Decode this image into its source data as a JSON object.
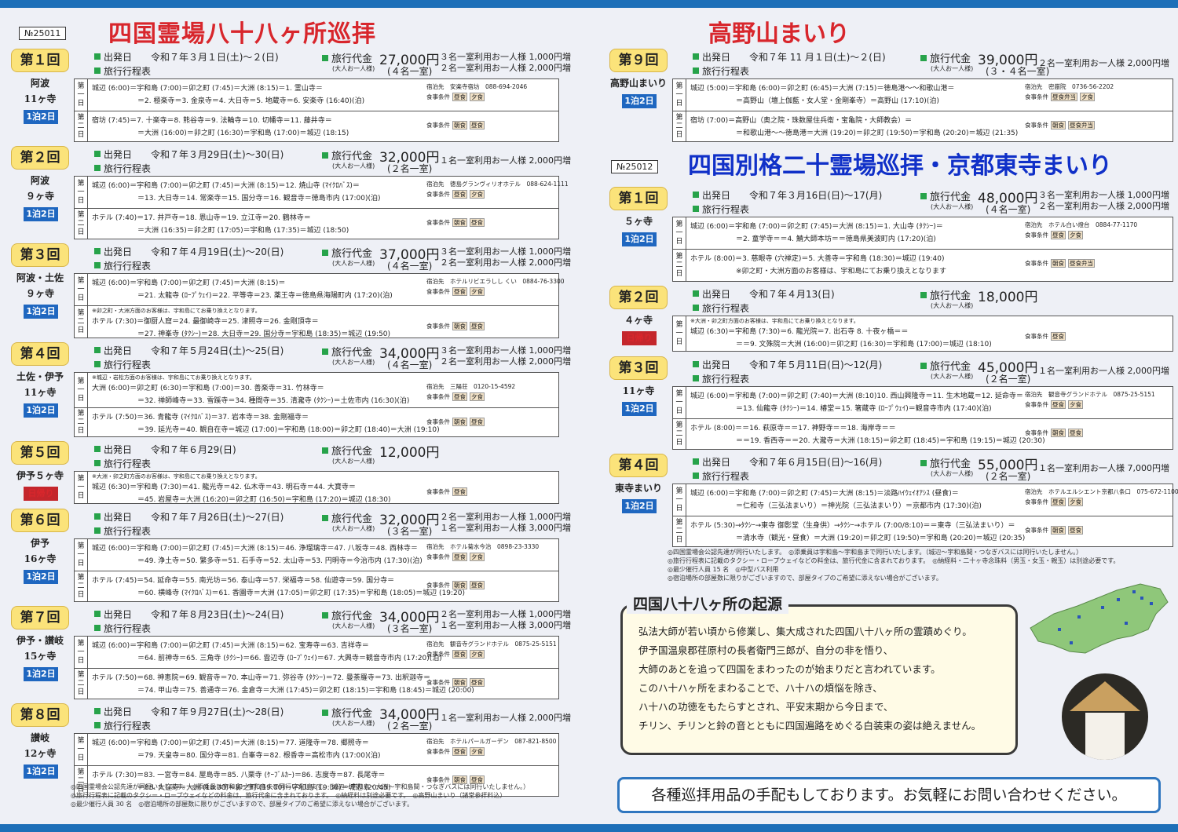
{
  "left": {
    "serial": "№25011",
    "title": "四国霊場八十八ヶ所巡拝",
    "trips": [
      {
        "badge": "第１回",
        "region": [
          "阿波",
          "11ヶ寺"
        ],
        "duration": "1泊2日",
        "date": "令和７年３月１日(土)～２(日)",
        "price": "27,000円",
        "occ": "(４名一室)",
        "extra": [
          "３名一室利用お一人様 1,000円増",
          "２名一室利用お一人様 2,000円増"
        ],
        "day1": [
          "城辺 (6:00)＝宇和島 (7:00)＝卯之町 (7:45)＝大洲 (8:15)＝1. 霊山寺＝",
          "＝2. 極楽寺＝3. 金泉寺＝4. 大日寺＝5. 地蔵寺＝6. 安楽寺 (16:40)(泊)"
        ],
        "lodge": "宿泊先　安楽寺宿坊　088-694-2046",
        "meal1": [
          "昼食",
          "夕食"
        ],
        "day2": [
          "宿坊 (7:45)＝7. 十楽寺＝8. 熊谷寺＝9. 法輪寺＝10. 切幡寺＝11. 藤井寺＝",
          "＝大洲 (16:00)＝卯之町 (16:30)＝宇和島 (17:00)＝城辺 (18:15)"
        ],
        "meal2": [
          "朝食",
          "昼食"
        ]
      },
      {
        "badge": "第２回",
        "region": [
          "阿波",
          "９ヶ寺"
        ],
        "duration": "1泊2日",
        "date": "令和７年３月29日(土)～30(日)",
        "price": "32,000円",
        "occ": "(２名一室)",
        "extra": [
          "１名一室利用お一人様 2,000円増"
        ],
        "day1": [
          "城辺 (6:00)＝宇和島 (7:00)＝卯之町 (7:45)＝大洲 (8:15)＝12. 焼山寺 (ﾏｲｸﾛﾊﾞｽ)＝",
          "＝13. 大日寺＝14. 常楽寺＝15. 国分寺＝16. 観音寺＝徳島市内 (17:00)(泊)"
        ],
        "lodge": "宿泊先　徳島グランヴィリオホテル　088-624-1111",
        "meal1": [
          "昼食",
          "夕食"
        ],
        "day2": [
          "ホテル (7:40)＝17. 井戸寺＝18. 恩山寺＝19. 立江寺＝20. 鶴林寺＝",
          "＝大洲 (16:35)＝卯之町 (17:05)＝宇和島 (17:35)＝城辺 (18:50)"
        ],
        "meal2": [
          "朝食",
          "昼食"
        ]
      },
      {
        "badge": "第３回",
        "region": [
          "阿波・土佐",
          "９ヶ寺"
        ],
        "duration": "1泊2日",
        "date": "令和７年４月19日(土)～20(日)",
        "price": "37,000円",
        "occ": "(４名一室)",
        "extra": [
          "３名一室利用お一人様 1,000円増",
          "２名一室利用お一人様 2,000円増"
        ],
        "day1": [
          "城辺 (6:00)＝宇和島 (7:00)＝卯之町 (7:45)＝大洲 (8:15)＝",
          "＝21. 太龍寺 (ﾛｰﾌﾟｳｪｲ)＝22. 平等寺＝23. 薬王寺＝徳島県海陽町内 (17:20)(泊)"
        ],
        "lodge": "宿泊先　ホテルリビエラしし くい　0884-76-3300",
        "meal1": [
          "昼食",
          "夕食"
        ],
        "day2": [
          "ホテル (7:30)＝御厨人窟＝24. 最御崎寺＝25. 津照寺＝26. 金剛頂寺＝",
          "＝27. 神峯寺 (ﾀｸｼｰ)＝28. 大日寺＝29. 国分寺＝宇和島 (18:35)＝城辺 (19:50)"
        ],
        "meal2": [
          "朝食",
          "昼食"
        ],
        "note2": "※卯之町・大洲方面のお客様は、宇和島にてお乗り換えとなります。"
      },
      {
        "badge": "第４回",
        "region": [
          "土佐・伊予",
          "11ヶ寺"
        ],
        "duration": "1泊2日",
        "date": "令和７年５月24日(土)～25(日)",
        "price": "34,000円",
        "occ": "(４名一室)",
        "extra": [
          "３名一室利用お一人様 1,000円増",
          "２名一室利用お一人様 2,000円増"
        ],
        "note1": "※城辺・岩松方面のお客様は、宇和島にてお乗り換えとなります。",
        "day1": [
          "大洲 (6:00)＝卯之町 (6:30)＝宇和島 (7:00)＝30. 善楽寺＝31. 竹林寺＝",
          "＝32. 禅師峰寺＝33. 雪蹊寺＝34. 種間寺＝35. 清瀧寺 (ﾀｸｼｰ)＝土佐市内 (16:30)(泊)"
        ],
        "lodge": "宿泊先　三陽荘　0120-15-4592",
        "meal1": [
          "昼食",
          "夕食"
        ],
        "day2": [
          "ホテル (7:50)＝36. 青龍寺 (ﾏｲｸﾛﾊﾞｽ)＝37. 岩本寺＝38. 金剛福寺＝",
          "＝39. 延光寺＝40. 観自在寺＝城辺 (17:00)＝宇和島 (18:00)＝卯之町 (18:40)＝大洲 (19:10)"
        ],
        "meal2": [
          "朝食",
          "昼食"
        ]
      },
      {
        "badge": "第５回",
        "region": [
          "伊予５ヶ寺"
        ],
        "duration": "日帰り",
        "date": "令和７年６月29(日)",
        "price": "12,000円",
        "occ": "",
        "extra": [],
        "note1": "※大洲・卯之町方面のお客様は、宇和島にてお乗り換えとなります。",
        "day1": [
          "城辺 (6:30)＝宇和島 (7:30)＝41. 龍光寺＝42. 仏木寺＝43. 明石寺＝44. 大寶寺＝",
          "＝45. 岩屋寺＝大洲 (16:20)＝卯之町 (16:50)＝宇和島 (17:20)＝城辺 (18:30)"
        ],
        "meal1": [
          "昼食"
        ]
      },
      {
        "badge": "第６回",
        "region": [
          "伊予",
          "16ヶ寺"
        ],
        "duration": "1泊2日",
        "date": "令和７年７月26日(土)～27(日)",
        "price": "32,000円",
        "occ": "(３名一室)",
        "extra": [
          "２名一室利用お一人様 1,000円増",
          "１名一室利用お一人様 3,000円増"
        ],
        "day1": [
          "城辺 (6:00)＝宇和島 (7:00)＝卯之町 (7:45)＝大洲 (8:15)＝46. 浄瑠璃寺＝47. 八坂寺＝48. 西林寺＝",
          "＝49. 浄土寺＝50. 繁多寺＝51. 石手寺＝52. 太山寺＝53. 円明寺＝今治市内 (17:30)(泊)"
        ],
        "lodge": "宿泊先　ホテル菊水今治　0898-23-3330",
        "meal1": [
          "昼食",
          "夕食"
        ],
        "day2": [
          "ホテル (7:45)＝54. 延命寺＝55. 南光坊＝56. 泰山寺＝57. 栄福寺＝58. 仙遊寺＝59. 国分寺＝",
          "＝60. 横峰寺 (ﾏｲｸﾛﾊﾞｽ)＝61. 香園寺＝大洲 (17:05)＝卯之町 (17:35)＝宇和島 (18:05)＝城辺 (19:20)"
        ],
        "meal2": [
          "朝食",
          "昼食"
        ]
      },
      {
        "badge": "第７回",
        "region": [
          "伊予・讃岐",
          "15ヶ寺"
        ],
        "duration": "1泊2日",
        "date": "令和７年８月23日(土)～24(日)",
        "price": "34,000円",
        "occ": "(３名一室)",
        "extra": [
          "２名一室利用お一人様 1,000円増",
          "１名一室利用お一人様 3,000円増"
        ],
        "day1": [
          "城辺 (6:00)＝宇和島 (7:00)＝卯之町 (7:45)＝大洲 (8:15)＝62. 宝寿寺＝63. 吉祥寺＝",
          "＝64. 前神寺＝65. 三角寺 (ﾀｸｼｰ)＝66. 雲辺寺 (ﾛｰﾌﾟｳｪｲ)＝67. 大興寺＝観音寺市内 (17:20)(泊)"
        ],
        "lodge": "宿泊先　観音寺グランドホテル　0875-25-5151",
        "meal1": [
          "昼食",
          "夕食"
        ],
        "day2": [
          "ホテル (7:50)＝68. 神恵院＝69. 観音寺＝70. 本山寺＝71. 弥谷寺 (ﾀｸｼｰ)＝72. 曼荼羅寺＝73. 出釈迦寺＝",
          "＝74. 甲山寺＝75. 善通寺＝76. 金倉寺＝大洲 (17:45)＝卯之町 (18:15)＝宇和島 (18:45)＝城辺 (20:00)"
        ],
        "meal2": [
          "朝食",
          "昼食"
        ]
      },
      {
        "badge": "第８回",
        "region": [
          "讃岐",
          "12ヶ寺"
        ],
        "duration": "1泊2日",
        "date": "令和７年９月27日(土)～28(日)",
        "price": "34,000円",
        "occ": "(２名一室)",
        "extra": [
          "１名一室利用お一人様 2,000円増"
        ],
        "day1": [
          "城辺 (6:00)＝宇和島 (7:00)＝卯之町 (7:45)＝大洲 (8:15)＝77. 道隆寺＝78. 郷照寺＝",
          "＝79. 天皇寺＝80. 国分寺＝81. 白峯寺＝82. 根香寺＝高松市内 (17:00)(泊)"
        ],
        "lodge": "宿泊先　ホテルパールガーデン　087-821-8500",
        "meal1": [
          "昼食",
          "夕食"
        ],
        "day2": [
          "ホテル (7:30)＝83. 一宮寺＝84. 屋島寺＝85. 八栗寺 (ｹｰﾌﾞﾙｶｰ)＝86. 志度寺＝87. 長尾寺＝",
          "＝88. 大窪寺＝大洲 (18:30)＝卯之町 (19:00)＝宇和島 (19:30)＝城辺 (20:45)"
        ],
        "meal2": [
          "朝食",
          "昼食"
        ]
      }
    ],
    "notes": [
      "◎四国霊場会公認先達が同行いたします。　◎添乗員は宇和島～宇和島まで同行いたします。（城辺～宇和島・大洲～宇和島間・つなぎバスには同行いたしません。）",
      "◎旅行行程表に記載のタクシー・ロープウェイなどの料金は、旅行代金に含まれております。　◎納経料は別途必要です。　◎高野山まいり（諸堂参拝料込）",
      "◎最少催行人員 30 名　◎宿泊場所の部屋数に限りがございますので、部屋タイプのご希望に添えない場合がございます。"
    ]
  },
  "right": {
    "title1": "高野山まいり",
    "koya": {
      "badge": "第９回",
      "region": [
        "高野山まいり"
      ],
      "duration": "1泊2日",
      "date": "令和７年 11 月１日(土)～２(日)",
      "price": "39,000円",
      "occ": "(３・４名一室)",
      "extra": [
        "２名一室利用お一人様 2,000円増"
      ],
      "day1": [
        "城辺 (5:00)＝宇和島 (6:00)＝卯之町 (6:45)＝大洲 (7:15)＝徳島港～～和歌山港＝",
        "＝高野山（壇上伽藍・女人堂・金剛峯寺）＝高野山 (17:10)(泊)"
      ],
      "lodge": "宿泊先　密厳院　0736-56-2202",
      "meal1": [
        "昼食弁当",
        "夕食"
      ],
      "day2": [
        "宿坊 (7:00)＝高野山（奥之院・珠数屋住兵衛・宝亀院・大師教会）＝",
        "＝和歌山港～～徳島港＝大洲 (19:20)＝卯之町 (19:50)＝宇和島 (20:20)＝城辺 (21:35)"
      ],
      "meal2": [
        "朝食",
        "昼食弁当"
      ]
    },
    "serial2": "№25012",
    "title2": "四国別格二十霊場巡拝・京都東寺まいり",
    "trips": [
      {
        "badge": "第１回",
        "region": [
          "５ヶ寺"
        ],
        "duration": "1泊2日",
        "date": "令和７年３月16日(日)～17(月)",
        "price": "48,000円",
        "occ": "(４名一室)",
        "extra": [
          "３名一室利用お一人様 1,000円増",
          "２名一室利用お一人様 2,000円増"
        ],
        "day1": [
          "城辺 (6:00)＝宇和島 (7:00)＝卯之町 (7:45)＝大洲 (8:15)＝1. 大山寺 (ﾀｸｼｰ)＝",
          "＝2. 童学寺＝＝4. 鯖大師本坊＝＝徳島県美波町内 (17:20)(泊)"
        ],
        "lodge": "宿泊先　ホテル白い燈台　0884-77-1170",
        "meal1": [
          "昼食",
          "夕食"
        ],
        "day2": [
          "ホテル (8:00)＝3. 慈眼寺 (穴禅定)＝5. 大善寺＝宇和島 (18:30)＝城辺 (19:40)",
          "※卯之町・大洲方面のお客様は、宇和島にてお乗り換えとなります"
        ],
        "meal2": [
          "朝食",
          "昼食弁当"
        ]
      },
      {
        "badge": "第２回",
        "region": [
          "４ヶ寺"
        ],
        "duration": "日帰り",
        "date": "令和７年４月13(日)",
        "price": "18,000円",
        "occ": "",
        "extra": [],
        "note1": "※大洲・卯之町方面のお客様は、宇和島にてお乗り換えとなります。",
        "day1": [
          "城辺 (6:30)＝宇和島 (7:30)＝6. 龍光院＝7. 出石寺 8. 十夜ヶ橋＝＝",
          "＝＝9. 文殊院＝大洲 (16:00)＝卯之町 (16:30)＝宇和島 (17:00)＝城辺 (18:10)"
        ],
        "meal1": [
          "昼食"
        ]
      },
      {
        "badge": "第３回",
        "region": [
          "11ヶ寺"
        ],
        "duration": "1泊2日",
        "date": "令和７年５月11日(日)～12(月)",
        "price": "45,000円",
        "occ": "(２名一室)",
        "extra": [
          "１名一室利用お一人様 2,000円増"
        ],
        "day1": [
          "城辺 (6:00)＝宇和島 (7:00)＝卯之町 (7:40)＝大洲 (8:10)10. 西山興隆寺＝11. 生木地蔵＝12. 延命寺＝",
          "＝13. 仙龍寺 (ﾀｸｼｰ)＝14. 椿堂＝15. 箸蔵寺 (ﾛｰﾌﾟｳｪｲ)＝観音寺市内 (17:40)(泊)"
        ],
        "lodge": "宿泊先　観音寺グランドホテル　0875-25-5151",
        "meal1": [
          "昼食",
          "夕食"
        ],
        "day2": [
          "ホテル (8:00)＝＝16. 萩原寺＝＝17. 神野寺＝＝18. 海岸寺＝＝",
          "＝＝19. 香西寺＝＝20. 大瀧寺＝大洲 (18:15)＝卯之町 (18:45)＝宇和島 (19:15)＝城辺 (20:30)"
        ],
        "meal2": [
          "朝食",
          "昼食"
        ]
      },
      {
        "badge": "第４回",
        "region": [
          "東寺まいり"
        ],
        "duration": "1泊2日",
        "date": "令和７年６月15日(日)～16(月)",
        "price": "55,000円",
        "occ": "(２名一室)",
        "extra": [
          "１名一室利用お一人様 7,000円増"
        ],
        "day1": [
          "城辺 (6:00)＝宇和島 (7:00)＝卯之町 (7:45)＝大洲 (8:15)＝淡路ﾊｲｳｪｲｵｱｼｽ (昼食)＝",
          "＝仁和寺（三弘法まいり）＝神光院（三弘法まいり）＝京都市内 (17:30)(泊)"
        ],
        "lodge": "宿泊先　ホテルエルシエント京都八条口　075-672-1100",
        "meal1": [
          "昼食",
          "夕食"
        ],
        "day2": [
          "ホテル (5:30)→ﾀｸｼｰ→東寺 御影堂（生身供）→ﾀｸｼｰ→ホテル (7:00/8:10)＝＝東寺（三弘法まいり）＝",
          "＝清水寺（観光・昼食）＝大洲 (19:20)＝卯之町 (19:50)＝宇和島 (20:20)＝城辺 (20:35)"
        ],
        "meal2": [
          "朝食",
          "昼食"
        ]
      }
    ],
    "notes": [
      "◎四国霊場会公認先達が同行いたします。　◎添乗員は宇和島～宇和島まで同行いたします。（城辺～宇和島間・つなぎバスには同行いたしません。）",
      "◎旅行行程表に記載のタクシー・ロープウェイなどの料金は、旅行代金に含まれております。　◎納経料・二十ヶ寺念珠料（男玉・女玉・親玉）は別途必要です。",
      "◎最少催行人員 15 名　◎中型バス利用",
      "◎宿泊場所の部屋数に限りがございますので、部屋タイプのご希望に添えない場合がございます。"
    ],
    "origin": {
      "title": "四国八十八ヶ所の起源",
      "lines": [
        "弘法大師が若い頃から修業し、集大成された四国八十八ヶ所の霊蹟めぐり。",
        "伊予国温泉郡荏原村の長者衛門三郎が、自分の非を悟り、",
        "大師のあとを追って四国をまわったのが始まりだと言われています。",
        "このハ十ハヶ所をまわることで、ハ十ハの煩悩を除き、",
        "ハ十ハの功徳をもたらすとされ、平安末期から今日まで、",
        "チリン、チリンと鈴の音とともに四国遍路をめぐる白装束の姿は絶えません。"
      ]
    },
    "bottom": "各種巡拝用品の手配もしております。お気軽にお問い合わせください。"
  },
  "labels": {
    "depart": "出発日",
    "itinerary": "旅行行程表",
    "price": "旅行代金",
    "price_sub": "(大人お一人様)",
    "day1": [
      "第",
      "一",
      "日"
    ],
    "day2": [
      "第",
      "二",
      "日"
    ],
    "meal": "食事条件"
  },
  "colors": {
    "red": "#d8262c",
    "blue": "#1030c8",
    "bar": "#1d6fb8",
    "badge": "#fbe37a"
  }
}
